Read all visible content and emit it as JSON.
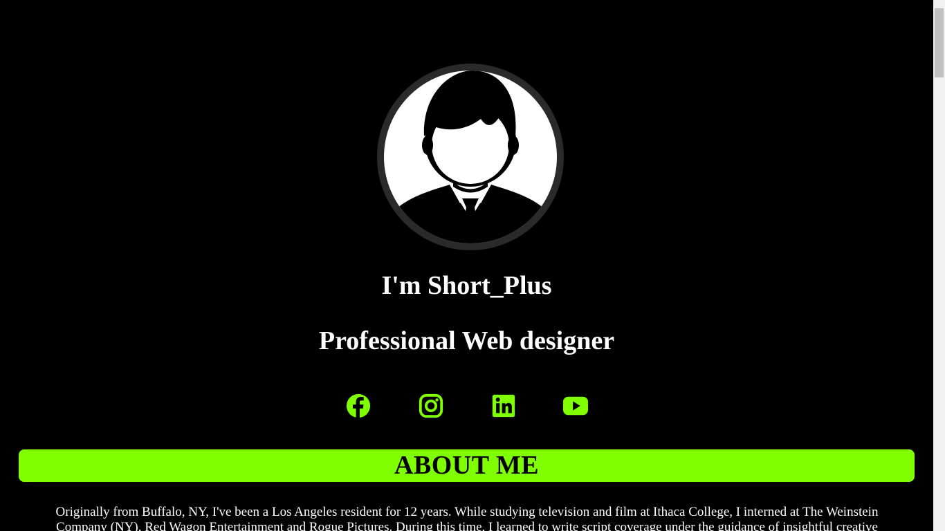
{
  "profile": {
    "avatar_icon": "person-silhouette-avatar",
    "name": "I'm Short_Plus",
    "role": "Professional Web designer"
  },
  "social": [
    {
      "icon": "facebook-icon"
    },
    {
      "icon": "instagram-icon"
    },
    {
      "icon": "linkedin-icon"
    },
    {
      "icon": "youtube-icon"
    }
  ],
  "about": {
    "title": "ABOUT ME",
    "text": "Originally from Buffalo, NY, I've been a Los Angeles resident for 12 years. While studying television and film at Ithaca College, I interned at The Weinstein Company (NY), Red Wagon Entertainment and Rogue Pictures. During this time, I learned to write script coverage under the guidance of insightful creative"
  },
  "colors": {
    "background": "#000000",
    "accent": "#80ff00",
    "text": "#ffffff"
  }
}
